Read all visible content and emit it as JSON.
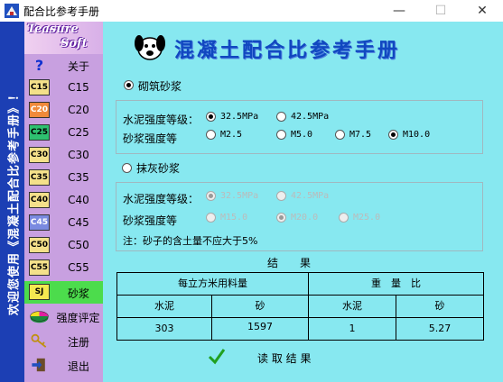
{
  "window": {
    "title": "配合比参考手册",
    "minimize": "—",
    "maximize": "☐",
    "close": "✕"
  },
  "banner": {
    "text": "欢迎您使用《混凝土配合比参考手册》！"
  },
  "sidebar": {
    "logo_line1": "Teasure",
    "logo_line2": "Soft",
    "items": [
      {
        "icon": "?",
        "label": "关于"
      },
      {
        "icon": "C15",
        "label": "C15"
      },
      {
        "icon": "C20",
        "label": "C20"
      },
      {
        "icon": "C25",
        "label": "C25"
      },
      {
        "icon": "C30",
        "label": "C30"
      },
      {
        "icon": "C35",
        "label": "C35"
      },
      {
        "icon": "C40",
        "label": "C40"
      },
      {
        "icon": "C45",
        "label": "C45"
      },
      {
        "icon": "C50",
        "label": "C50"
      },
      {
        "icon": "C55",
        "label": "C55"
      },
      {
        "icon": "SJ",
        "label": "砂浆"
      },
      {
        "icon": "",
        "label": "强度评定"
      },
      {
        "icon": "",
        "label": "注册"
      },
      {
        "icon": "",
        "label": "退出"
      }
    ],
    "selected_index": 10
  },
  "main": {
    "title": "混凝土配合比参考手册",
    "masonry": {
      "label": "砌筑砂浆",
      "checked": true,
      "cement_label": "水泥强度等级：",
      "cement_options": [
        "32.5MPa",
        "42.5MPa"
      ],
      "cement_selected": "32.5MPa",
      "mortar_label": "砂浆强度等",
      "mortar_options": [
        "M2.5",
        "M5.0",
        "M7.5",
        "M10.0"
      ],
      "mortar_selected": "M10.0"
    },
    "plaster": {
      "label": "抹灰砂浆",
      "checked": false,
      "cement_label": "水泥强度等级：",
      "cement_options": [
        "32.5MPa",
        "42.5MPa"
      ],
      "cement_selected": "32.5MPa",
      "mortar_label": "砂浆强度等",
      "mortar_options": [
        "M15.0",
        "M20.0",
        "M25.0"
      ],
      "mortar_selected": "M20.0",
      "note": "注：砂子的含土量不应大于5%"
    },
    "results": {
      "heading": "结　　果",
      "group1_header": "每立方米用料量",
      "group2_header": "重　量　比",
      "columns": [
        "水泥",
        "砂",
        "水泥",
        "砂"
      ],
      "values": [
        "303",
        "1597",
        "1",
        "5.27"
      ]
    },
    "read_button": "读 取 结 果"
  }
}
